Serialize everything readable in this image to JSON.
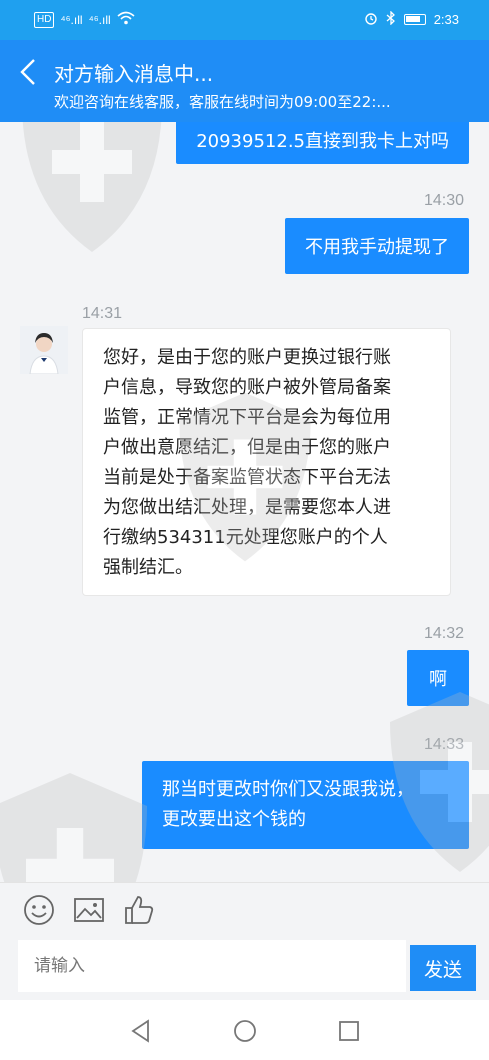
{
  "status_bar": {
    "network_label": "HD",
    "signal_1": "⁴⁶.ıll",
    "signal_2": "⁴⁶.ıll",
    "time": "2:33",
    "icons": [
      "alarm-icon",
      "bluetooth-icon",
      "battery-icon",
      "wifi-icon"
    ]
  },
  "header": {
    "title": "对方输入消息中...",
    "subtitle": "欢迎咨询在线客服，客服在线时间为09:00至22:...",
    "back_icon": "chevron-left-icon"
  },
  "messages": [
    {
      "type": "outgoing",
      "text": "20939512.5直接到我卡上对吗"
    },
    {
      "type": "time",
      "text": "14:30"
    },
    {
      "type": "outgoing",
      "text": "不用我手动提现了"
    },
    {
      "type": "time",
      "text": "14:31"
    },
    {
      "type": "incoming",
      "lines": [
        "您好，是由于您的账户更换过银行账",
        "户信息，导致您的账户被外管局备案",
        "监管，正常情况下平台是会为每位用",
        "户做出意愿结汇，但是由于您的账户",
        "当前是处于备案监管状态下平台无法",
        "为您做出结汇处理，是需要您本人进",
        "行缴纳534311元处理您账户的个人",
        "强制结汇。"
      ]
    },
    {
      "type": "time",
      "text": "14:32"
    },
    {
      "type": "outgoing",
      "text": "啊"
    },
    {
      "type": "time",
      "text": "14:33"
    },
    {
      "type": "outgoing",
      "lines": [
        "那当时更改时你们又没跟我说，",
        "更改要出这个钱的"
      ]
    }
  ],
  "toolbar": {
    "icons": [
      "emoji-icon",
      "image-icon",
      "thumbs-up-icon"
    ]
  },
  "composer": {
    "placeholder": "请输入",
    "send_label": "发送"
  },
  "colors": {
    "header": "#1f8df6",
    "bubble_out": "#1a8cff",
    "background": "#f3f4f6"
  }
}
